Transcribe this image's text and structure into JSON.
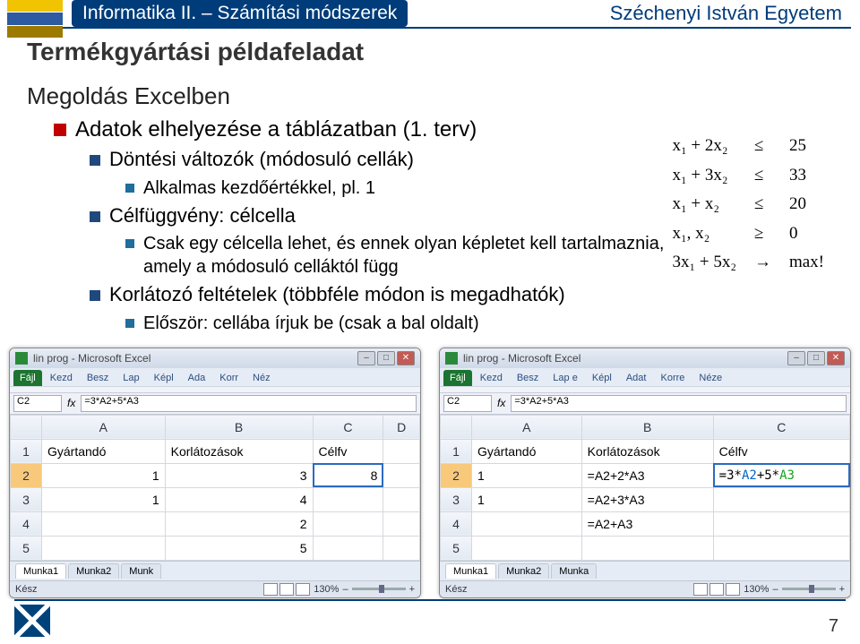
{
  "header": {
    "course": "Informatika II. – Számítási módszerek",
    "university": "Széchenyi István Egyetem"
  },
  "title": "Termékgyártási példafeladat",
  "subtitle": "Megoldás Excelben",
  "bullets": {
    "b1": "Adatok elhelyezése a táblázatban (1. terv)",
    "b1a": "Döntési változók (módosuló cellák)",
    "b1a1": "Alkalmas kezdőértékkel, pl. 1",
    "b1b": "Célfüggvény: célcella",
    "b1b1": "Csak egy célcella lehet, és ennek olyan képletet kell tartalmaznia, amely a módosuló celláktól függ",
    "b1c": "Korlátozó feltételek (többféle módon is megadhatók)",
    "b1c1": "Először: cellába írjuk be (csak a bal oldalt)"
  },
  "math": {
    "r1l": "x₁ + 2x₂",
    "r1o": "≤",
    "r1r": "25",
    "r2l": "x₁ + 3x₂",
    "r2o": "≤",
    "r2r": "33",
    "r3l": "x₁ + x₂",
    "r3o": "≤",
    "r3r": "20",
    "r4l": "x₁, x₂",
    "r4o": "≥",
    "r4r": "0",
    "r5l": "3x₁ + 5x₂",
    "r5o": "→",
    "r5r": "max!"
  },
  "excel": {
    "winTitle": "lin prog - Microsoft Excel",
    "tabsLeft": [
      "Fájl",
      "Kezd",
      "Besz",
      "Lap",
      "Képl",
      "Ada",
      "Korr",
      "Néz"
    ],
    "tabsRight": [
      "Fájl",
      "Kezd",
      "Besz",
      "Lap e",
      "Képl",
      "Adat",
      "Korre",
      "Néze"
    ],
    "nameboxL": "C2",
    "formulaL": "=3*A2+5*A3",
    "nameboxR": "C2",
    "formulaR": "=3*A2+5*A3",
    "hdrA": "A",
    "hdrB": "B",
    "hdrC": "C",
    "hdrD": "D",
    "h1": "Gyártandó",
    "h2": "Korlátozások",
    "h3": "Célfv",
    "left": {
      "r2": {
        "a": "1",
        "b": "3",
        "c": "8"
      },
      "r3": {
        "a": "1",
        "b": "4"
      },
      "r4": {
        "b": "2"
      },
      "r5": {
        "b": "5"
      }
    },
    "right": {
      "r2": {
        "a": "1",
        "b": "=A2+2*A3",
        "c": "=3*A2+5*A3"
      },
      "r3": {
        "a": "1",
        "b": "=A2+3*A3"
      },
      "r4": {
        "b": "=A2+A3"
      }
    },
    "sheetTabs": [
      "Munka1",
      "Munka2",
      "Munk"
    ],
    "sheetTabsR": [
      "Munka1",
      "Munka2",
      "Munka"
    ],
    "status": "Kész",
    "zoom": "130%"
  },
  "page": "7"
}
